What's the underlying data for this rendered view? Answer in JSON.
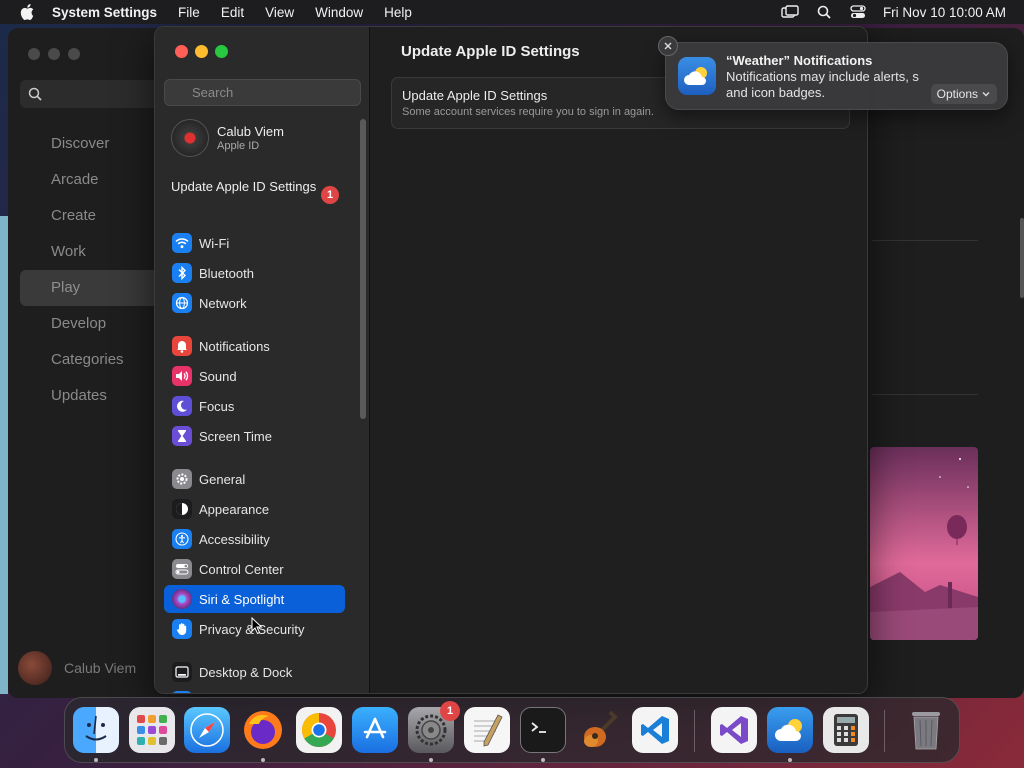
{
  "menubar": {
    "app_name": "System Settings",
    "menus": [
      "File",
      "Edit",
      "View",
      "Window",
      "Help"
    ],
    "clock": "Fri Nov 10  10:00 AM"
  },
  "background_app": {
    "nav": [
      "Discover",
      "Arcade",
      "Create",
      "Work",
      "Play",
      "Develop",
      "Categories",
      "Updates"
    ],
    "selected": "Play",
    "user": "Calub Viem"
  },
  "settings": {
    "search_placeholder": "Search",
    "account": {
      "name": "Calub Viem",
      "subtitle": "Apple ID"
    },
    "update_row": {
      "label": "Update Apple ID Settings",
      "badge": "1"
    },
    "sidebar_items": [
      {
        "label": "Wi-Fi",
        "icon": "wifi-icon",
        "color": "#1a7ff0"
      },
      {
        "label": "Bluetooth",
        "icon": "bluetooth-icon",
        "color": "#1a7ff0"
      },
      {
        "label": "Network",
        "icon": "globe-icon",
        "color": "#1a7ff0"
      },
      {
        "label": "Notifications",
        "icon": "bell-icon",
        "color": "#e8453c"
      },
      {
        "label": "Sound",
        "icon": "speaker-icon",
        "color": "#e8336a"
      },
      {
        "label": "Focus",
        "icon": "moon-icon",
        "color": "#5e4fd6"
      },
      {
        "label": "Screen Time",
        "icon": "hourglass-icon",
        "color": "#6a4fd6"
      },
      {
        "label": "General",
        "icon": "gear-icon",
        "color": "#8a8a8e"
      },
      {
        "label": "Appearance",
        "icon": "appearance-icon",
        "color": "#1c1c1e"
      },
      {
        "label": "Accessibility",
        "icon": "accessibility-icon",
        "color": "#1a7ff0"
      },
      {
        "label": "Control Center",
        "icon": "toggles-icon",
        "color": "#8a8a8e"
      },
      {
        "label": "Siri & Spotlight",
        "icon": "siri-icon",
        "color": "#b04ac8"
      },
      {
        "label": "Privacy & Security",
        "icon": "hand-icon",
        "color": "#1a7ff0"
      },
      {
        "label": "Desktop & Dock",
        "icon": "dock-icon",
        "color": "#1c1c1e"
      }
    ],
    "selected_item": "Siri & Spotlight",
    "detail": {
      "title": "Update Apple ID Settings",
      "card_title": "Update Apple ID Settings",
      "card_subtitle": "Some account services require you to sign in again."
    }
  },
  "notification": {
    "title": "“Weather” Notifications",
    "body": "Notifications may include alerts, s... and icon badges.",
    "body_line1": "Notifications may include alerts, s",
    "body_line2": "and icon badges.",
    "options_label": "Options",
    "app_icon": "weather-icon"
  },
  "dock": {
    "apps": [
      "Finder",
      "Launchpad",
      "Safari",
      "Firefox",
      "Chrome",
      "App Store",
      "System Settings",
      "TextEdit",
      "Terminal",
      "GarageBand",
      "VS Code",
      "Visual Studio",
      "Weather",
      "Calculator",
      "Trash"
    ],
    "settings_badge": "1"
  }
}
